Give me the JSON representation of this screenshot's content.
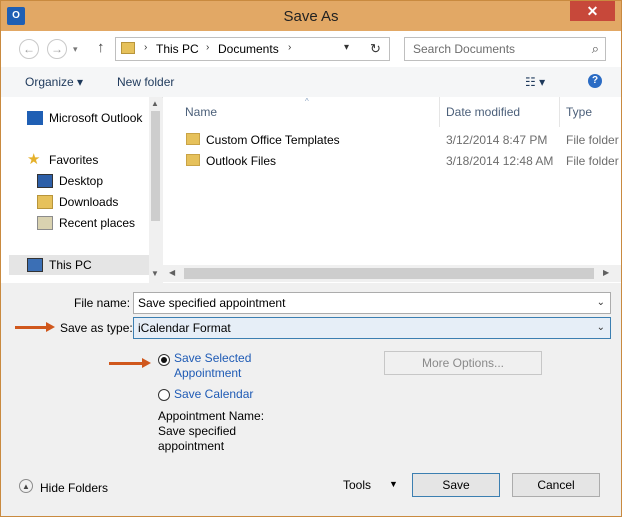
{
  "window": {
    "title": "Save As",
    "app_icon": "outlook-icon",
    "close_glyph": "✕"
  },
  "nav": {
    "back": "←",
    "forward": "→",
    "up": "↑",
    "breadcrumb": [
      "This PC",
      "Documents"
    ],
    "search_placeholder": "Search Documents"
  },
  "toolbar": {
    "organize": "Organize ▾",
    "new_folder": "New folder",
    "view": "☷ ▾",
    "help": "?"
  },
  "sidebar": {
    "items": [
      {
        "label": "Microsoft Outlook",
        "icon": "outlook-icon"
      },
      {
        "label": "Favorites",
        "icon": "star-icon"
      },
      {
        "label": "Desktop",
        "icon": "desktop-icon"
      },
      {
        "label": "Downloads",
        "icon": "downloads-icon"
      },
      {
        "label": "Recent places",
        "icon": "recent-places-icon"
      },
      {
        "label": "This PC",
        "icon": "computer-icon"
      }
    ]
  },
  "files": {
    "columns": [
      "Name",
      "Date modified",
      "Type"
    ],
    "rows": [
      {
        "name": "Custom Office Templates",
        "date": "3/12/2014 8:47 PM",
        "type": "File folder"
      },
      {
        "name": "Outlook Files",
        "date": "3/18/2014 12:48 AM",
        "type": "File folder"
      }
    ]
  },
  "form": {
    "file_name_label": "File name:",
    "file_name_value": "Save specified appointment",
    "save_type_label": "Save as type:",
    "save_type_value": "iCalendar Format",
    "option_selected": "Save Selected Appointment",
    "option_calendar": "Save Calendar",
    "more_options": "More Options...",
    "appointment_name_label": "Appointment Name:",
    "appointment_name_value": "Save specified appointment"
  },
  "footer": {
    "hide_folders": "Hide Folders",
    "tools": "Tools",
    "save": "Save",
    "cancel": "Cancel"
  },
  "colors": {
    "title_bar": "#e2a865",
    "annotation_arrow": "#d0571c",
    "link_blue": "#1f5bb5"
  }
}
